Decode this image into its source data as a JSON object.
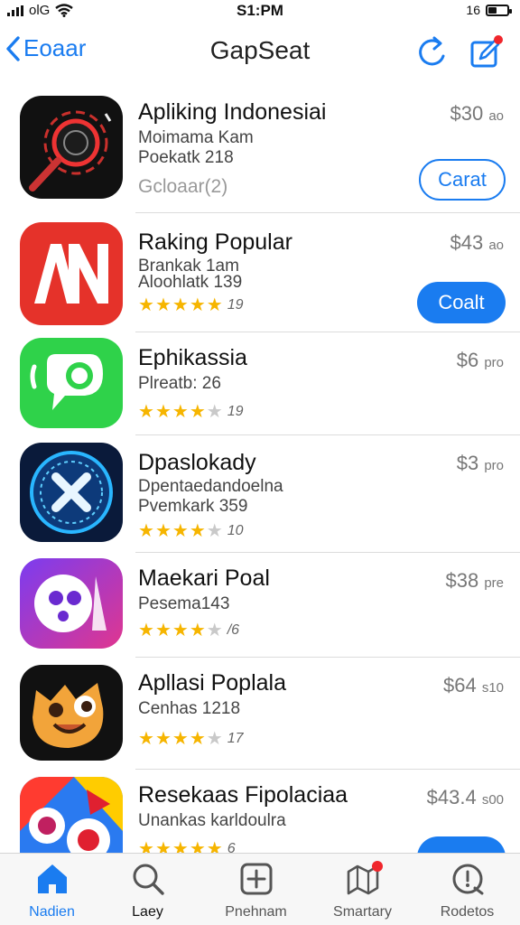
{
  "status_bar": {
    "carrier": "olG",
    "time": "S1:PM",
    "battery_label": "16"
  },
  "nav": {
    "back_label": "Eoaar",
    "title": "GapSeat"
  },
  "apps": [
    {
      "name": "Apliking Indonesiai",
      "line1": "Moimama Kam",
      "line2": "Poekatk 218",
      "line3": "Gcloaar(2)",
      "price": "$30",
      "price_unit": "ao",
      "button": "Carat"
    },
    {
      "name": "Raking Popular",
      "line1": "Brankak 1am",
      "line2": "Aloohlatk 139",
      "rating": 5,
      "rating_count": "19",
      "price": "$43",
      "price_unit": "ao",
      "button": "Coalt"
    },
    {
      "name": "Ephikassia",
      "line1": "Plreatb: 26",
      "rating": 4.5,
      "rating_count": "19",
      "price": "$6",
      "price_unit": "pro"
    },
    {
      "name": "Dpaslokady",
      "line1": "Dpentaedandoelna",
      "line2": "Pvemkark 359",
      "rating": 4,
      "rating_count": "10",
      "price": "$3",
      "price_unit": "pro"
    },
    {
      "name": "Maekari Poal",
      "line1": "Pesema143",
      "rating": 4.5,
      "rating_count": "/6",
      "price": "$38",
      "price_unit": "pre"
    },
    {
      "name": "Apllasi Poplala",
      "line1": "Cenhas 1218",
      "rating": 4.5,
      "rating_count": "17",
      "price": "$64",
      "price_unit": "s10"
    },
    {
      "name": "Resekaas Fipolaciaa",
      "line1": "Unankas karldoulra",
      "rating": 5,
      "rating_count": "6",
      "price": "$43.4",
      "price_unit": "s00"
    }
  ],
  "tabs": [
    {
      "label": "Nadien",
      "icon": "home-icon"
    },
    {
      "label": "Laey",
      "icon": "search-icon"
    },
    {
      "label": "Pnehnam",
      "icon": "add-square-icon"
    },
    {
      "label": "Smartary",
      "icon": "map-icon"
    },
    {
      "label": "Rodetos",
      "icon": "update-icon"
    }
  ],
  "colors": {
    "accent": "#1a7cf0",
    "star": "#f6b500",
    "badge": "#f0262c"
  }
}
